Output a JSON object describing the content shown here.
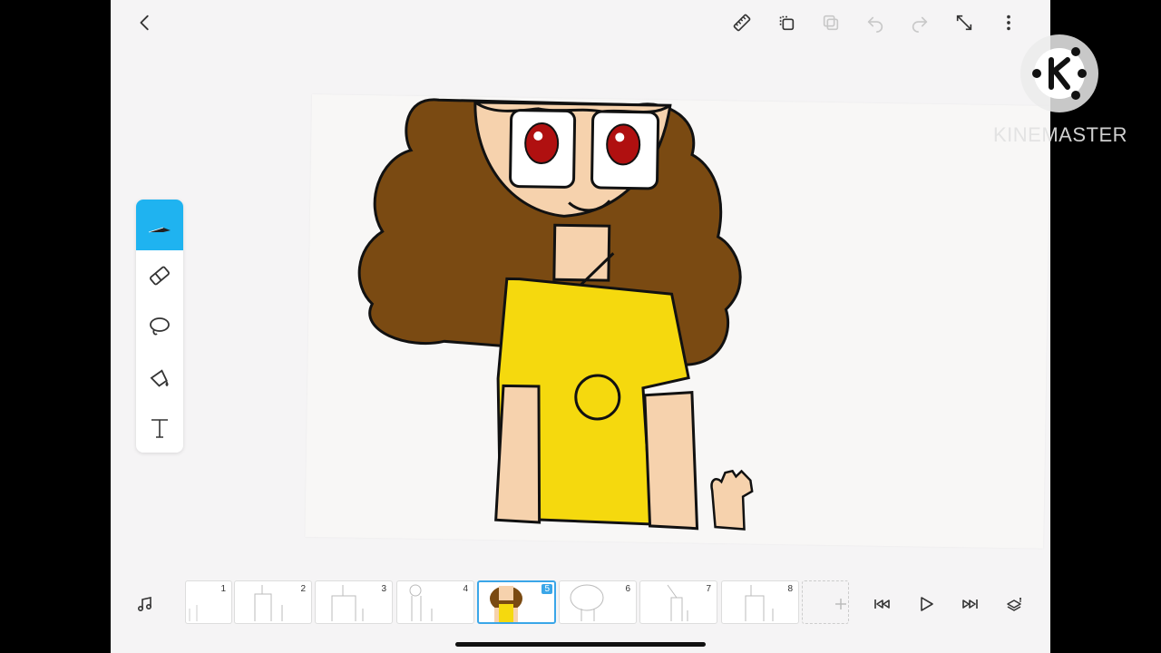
{
  "frames": [
    {
      "number": "1"
    },
    {
      "number": "2"
    },
    {
      "number": "3"
    },
    {
      "number": "4"
    },
    {
      "number": "5"
    },
    {
      "number": "6"
    },
    {
      "number": "7"
    },
    {
      "number": "8"
    }
  ],
  "active_frame": "5",
  "active_tool": "pen",
  "watermark": {
    "text": "KINEMASTER"
  },
  "colors": {
    "accent": "#1fb3f0",
    "frame_selected": "#3aa6e8",
    "hair": "#7a4a12",
    "skin": "#f6d2ad",
    "shirt": "#f5d90e",
    "eyes": "#b01010"
  },
  "icons": {
    "back": "chevron-left-icon",
    "ruler": "ruler-icon",
    "copy": "copy-icon",
    "paste": "paste-icon",
    "undo": "undo-icon",
    "redo": "redo-icon",
    "fullscreen": "expand-icon",
    "more": "more-vertical-icon",
    "music": "music-note-icon",
    "add_frame": "plus-icon",
    "first_frame": "skip-back-icon",
    "play": "play-icon",
    "last_frame": "skip-forward-icon",
    "layers": "layers-icon"
  }
}
